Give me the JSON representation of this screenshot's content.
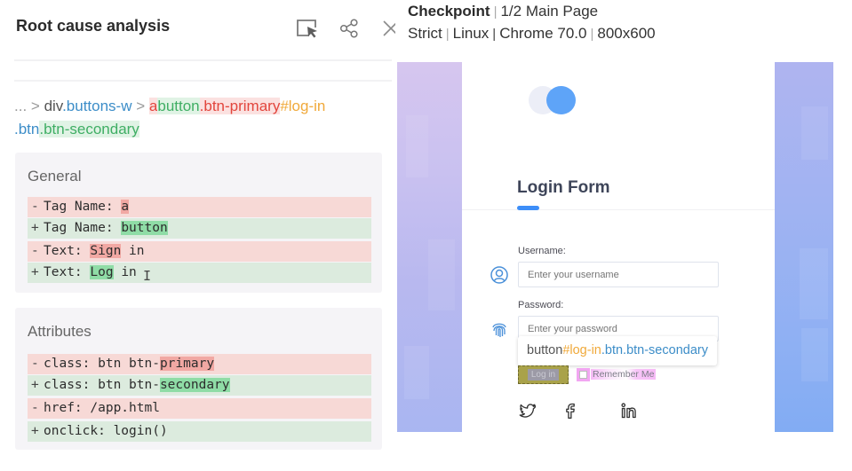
{
  "left_panel": {
    "title": "Root cause analysis",
    "icons": [
      "select-element-icon",
      "share-icon",
      "close-icon"
    ],
    "selector": {
      "prefix": "...",
      "sep1": ">",
      "parent_tag": "div",
      "parent_class": ".buttons-w",
      "sep2": ">",
      "removed_tag": "a",
      "added_tag": "button",
      "removed_class": ".btn-primary",
      "id": "#log-in",
      "class_btn": ".btn",
      "added_class": ".btn-secondary"
    },
    "general": {
      "title": "General",
      "rows": [
        {
          "type": "del",
          "mark": "-",
          "prefix": "Tag Name: ",
          "highlight": "a",
          "suffix": ""
        },
        {
          "type": "add",
          "mark": "+",
          "prefix": "Tag Name: ",
          "highlight": "button",
          "suffix": ""
        },
        {
          "type": "del",
          "mark": "-",
          "prefix": "Text: ",
          "highlight": "Sig",
          "highlight2": "n",
          "middle": "",
          "suffix": " in"
        },
        {
          "type": "add",
          "mark": "+",
          "prefix": "Text: ",
          "highlight": "Log",
          "suffix": " in"
        }
      ]
    },
    "attributes": {
      "title": "Attributes",
      "rows": [
        {
          "type": "del",
          "mark": "-",
          "prefix": "class: btn btn-",
          "highlight": "primary",
          "suffix": ""
        },
        {
          "type": "add",
          "mark": "+",
          "prefix": "class: btn btn-",
          "highlight": "secondary",
          "suffix": ""
        },
        {
          "type": "del",
          "mark": "-",
          "prefix": "href: /app.html",
          "highlight": "",
          "suffix": ""
        },
        {
          "type": "add",
          "mark": "+",
          "prefix": "onclick: login()",
          "highlight": "",
          "suffix": ""
        }
      ]
    }
  },
  "checkpoint": {
    "label": "Checkpoint",
    "step": "1/2 Main Page",
    "match_level": "Strict",
    "os": "Linux",
    "browser": "Chrome 70.0",
    "viewport": "800x600"
  },
  "page": {
    "form_title": "Login Form",
    "username_label": "Username:",
    "username_placeholder": "Enter your username",
    "password_label": "Password:",
    "password_placeholder": "Enter your password",
    "tooltip": {
      "tag": "button",
      "id": "#log-in",
      "classes": ".btn.btn-secondary"
    },
    "login_button": "Log in",
    "remember_me": "Remember Me",
    "social": [
      "twitter-icon",
      "facebook-icon",
      "linkedin-icon"
    ],
    "colors": {
      "accent": "#3d8ef8",
      "logo_blue": "#5ea4f8",
      "diff_removed": "#f7d9d6",
      "diff_added": "#dcebde"
    }
  }
}
